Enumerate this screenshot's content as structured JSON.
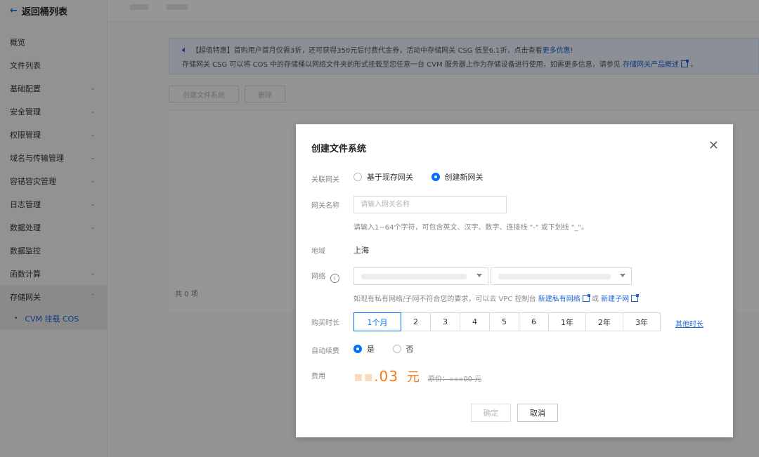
{
  "sidebar": {
    "back_label": "返回桶列表",
    "items": [
      {
        "label": "概览",
        "has_chevron": false
      },
      {
        "label": "文件列表",
        "has_chevron": false
      },
      {
        "label": "基础配置",
        "has_chevron": true
      },
      {
        "label": "安全管理",
        "has_chevron": true
      },
      {
        "label": "权限管理",
        "has_chevron": true
      },
      {
        "label": "域名与传输管理",
        "has_chevron": true
      },
      {
        "label": "容错容灾管理",
        "has_chevron": true
      },
      {
        "label": "日志管理",
        "has_chevron": true
      },
      {
        "label": "数据处理",
        "has_chevron": true
      },
      {
        "label": "数据监控",
        "has_chevron": false
      },
      {
        "label": "函数计算",
        "has_chevron": true
      },
      {
        "label": "存储网关",
        "has_chevron": true,
        "expanded": true
      }
    ],
    "sub_item": "CVM 挂载 COS"
  },
  "notice": {
    "line1_prefix": "【超值特惠】首购用户首月仅需3折，还可获得350元后付费代金券，活动中存储网关 CSG 低至6.1折，点击查看",
    "line1_link": "更多优惠",
    "line1_suffix": "!",
    "line2_prefix": "存储网关 CSG 可以将 COS 中的存储桶以网络文件夹的形式挂载至您任意一台 CVM 服务器上作为存储设备进行使用，如需更多信息，请参见",
    "line2_link": "存储网关产品概述",
    "line2_suffix": "。"
  },
  "toolbar": {
    "create_fs_label": "创建文件系统",
    "delete_label": "删除"
  },
  "list": {
    "total_label": "共 0 项"
  },
  "modal": {
    "title": "创建文件系统",
    "close_glyph": "✕",
    "gateway_label": "关联网关",
    "gateway_options": [
      "基于现存网关",
      "创建新网关"
    ],
    "gateway_selected": "创建新网关",
    "name_label": "网关名称",
    "name_placeholder": "请输入网关名称",
    "name_value": "",
    "name_hint": "请输入1~64个字符，可包含英文、汉字、数字、连接线 \"-\" 或下划线 \"_\"。",
    "region_label": "地域",
    "region_value": "上海",
    "network_label": "网络",
    "network_info_glyph": "i",
    "network_hint_prefix": "如现有私有网络/子网不符合您的要求，可以去 VPC 控制台",
    "network_link_vpc": "新建私有网络",
    "network_hint_or": "或",
    "network_link_subnet": "新建子网",
    "duration_label": "购买时长",
    "duration_options": [
      "1个月",
      "2",
      "3",
      "4",
      "5",
      "6",
      "1年",
      "2年",
      "3年"
    ],
    "duration_selected": "1个月",
    "duration_more": "其他时长",
    "autorenew_label": "自动续费",
    "autorenew_options": [
      "是",
      "否"
    ],
    "autorenew_selected": "是",
    "fee_label": "费用",
    "fee_amount_visible": ".03",
    "fee_unit": "元",
    "fee_original_prefix": "原价：",
    "fee_original_visible": "00 元",
    "confirm_label": "确定",
    "cancel_label": "取消"
  },
  "colors": {
    "accent": "#006eff",
    "link": "#1f65d6",
    "price": "#f47a1c"
  }
}
